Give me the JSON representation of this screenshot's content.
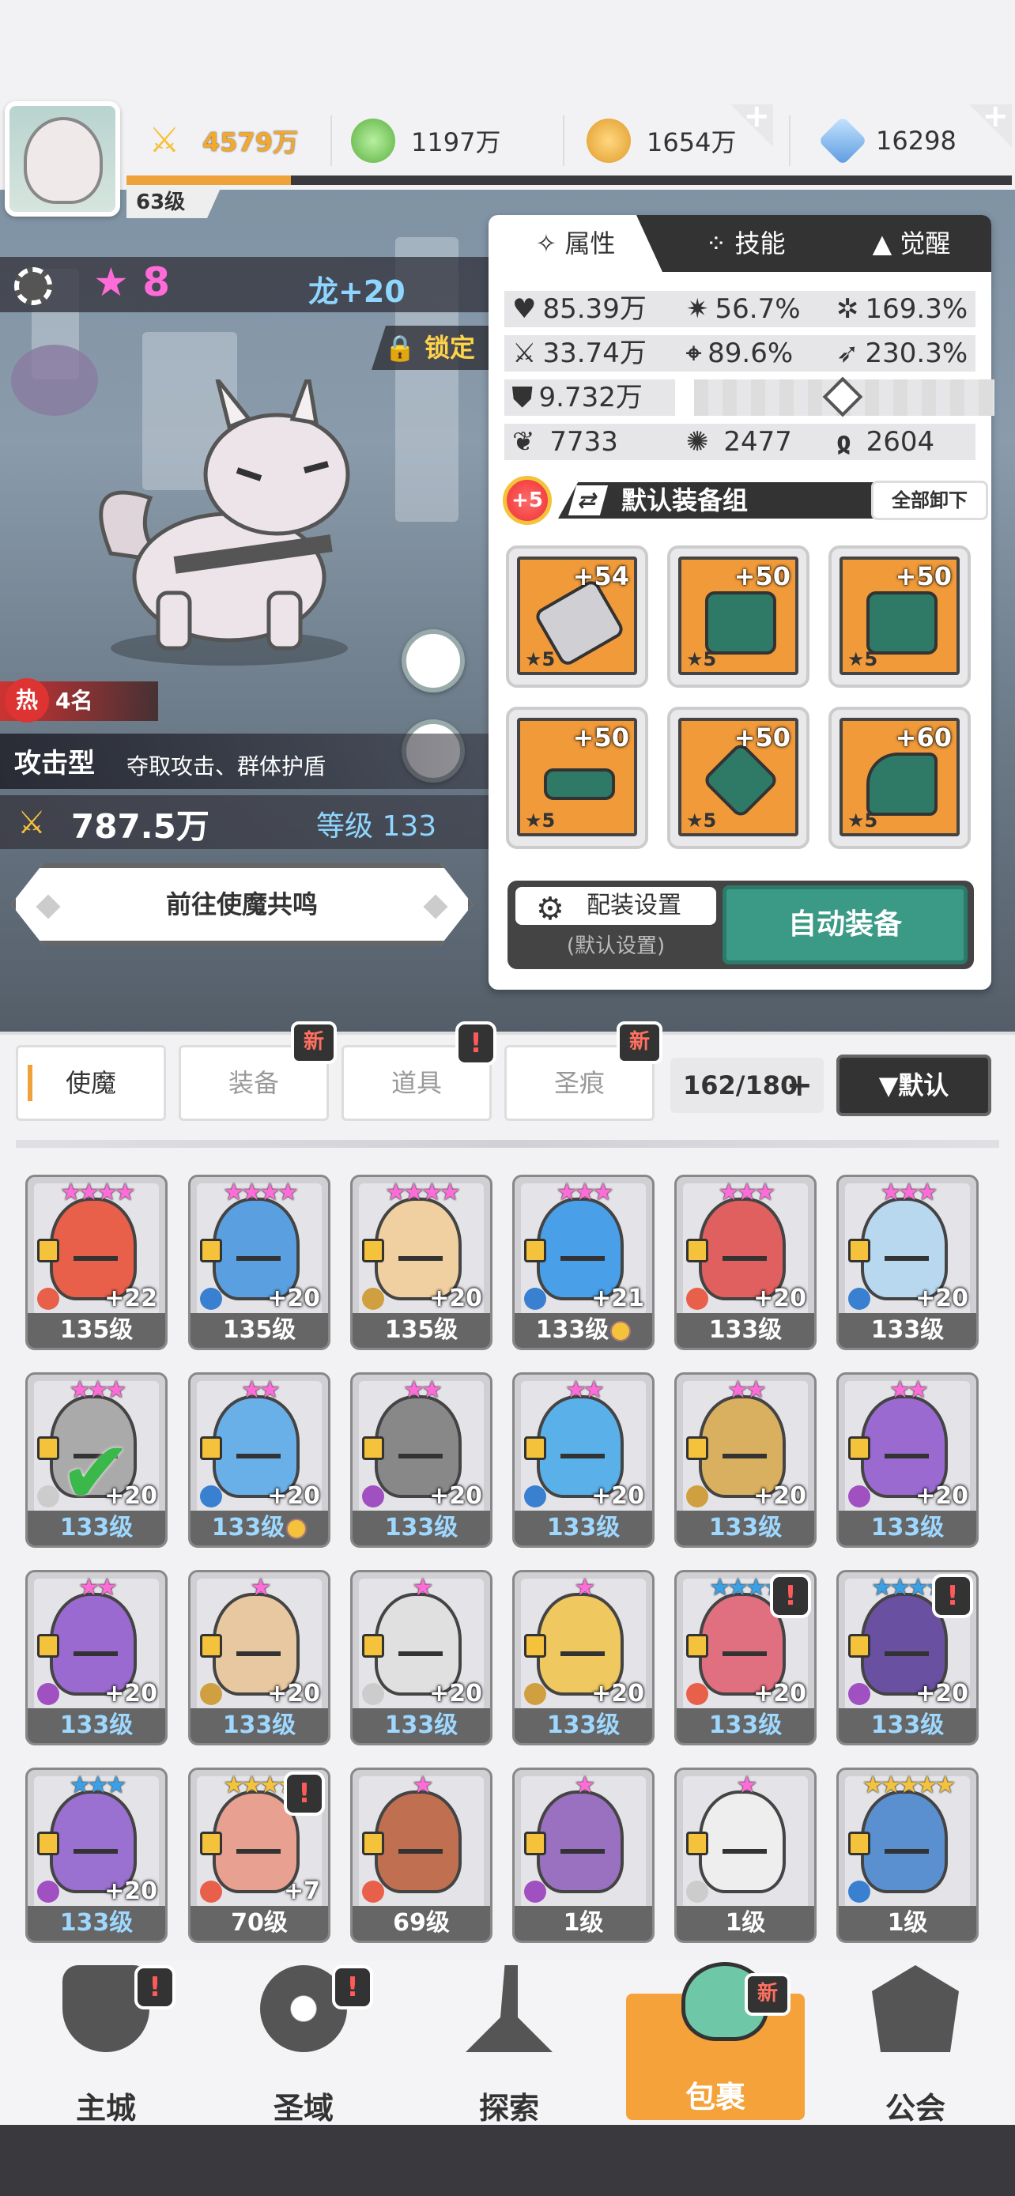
{
  "header": {
    "level": "63级",
    "currencies": [
      {
        "name": "power",
        "value": "4579万",
        "color": "#f5c23b"
      },
      {
        "name": "green-orb",
        "value": "1197万",
        "color": "#7fd060"
      },
      {
        "name": "gold-coin",
        "value": "1654万",
        "color": "#f0b43c"
      },
      {
        "name": "gem",
        "value": "16298",
        "color": "#7fb8f0"
      }
    ]
  },
  "hero": {
    "stars": "8",
    "title": "龙+20",
    "lock_label": "锁定",
    "hot_rank": "4名",
    "hot_icon": "热",
    "type": "攻击型",
    "type_desc": "夺取攻击、群体护盾",
    "power": "787.5万",
    "level": "等级 133",
    "resonance_button": "前往使魔共鸣"
  },
  "panel": {
    "tabs": [
      "属性",
      "技能",
      "觉醒"
    ],
    "stats": {
      "hp": "85.39万",
      "crit": "56.7%",
      "crit_dmg": "169.3%",
      "atk": "33.74万",
      "acc": "89.6%",
      "speed": "230.3%",
      "def": "9.732万",
      "a": "7733",
      "b": "2477",
      "c": "2604"
    },
    "enhance_badge": "+5",
    "equip_set": "默认装备组",
    "unequip_all": "全部卸下",
    "equipment": [
      {
        "level": "+54",
        "stars": "★5",
        "icon": "sword-icon"
      },
      {
        "level": "+50",
        "stars": "★5",
        "icon": "helmet-icon"
      },
      {
        "level": "+50",
        "stars": "★5",
        "icon": "armor-icon"
      },
      {
        "level": "+50",
        "stars": "★5",
        "icon": "belt-icon"
      },
      {
        "level": "+50",
        "stars": "★5",
        "icon": "necklace-icon"
      },
      {
        "level": "+60",
        "stars": "★5",
        "icon": "boots-icon"
      }
    ],
    "config_label": "配装设置",
    "config_sub": "(默认设置)",
    "auto_equip": "自动装备"
  },
  "categories": {
    "tabs": [
      "使魔",
      "装备",
      "道具",
      "圣痕"
    ],
    "new_label": "新",
    "alert_label": "!",
    "count": "162/180",
    "sort": "▼默认"
  },
  "heroes": [
    {
      "stars": "★★★★",
      "plus": "+22",
      "level": "135级",
      "color": "#e8604a",
      "elem": "#e8604a"
    },
    {
      "stars": "★★★★",
      "plus": "+20",
      "level": "135级",
      "color": "#5aa0e0",
      "elem": "#3a80d0"
    },
    {
      "stars": "★★★★",
      "plus": "+20",
      "level": "135级",
      "color": "#f0d0a0",
      "elem": "#d0a040"
    },
    {
      "stars": "★★★",
      "plus": "+21",
      "level": "133级",
      "color": "#4aa0e8",
      "elem": "#3a80d0"
    },
    {
      "stars": "★★★",
      "plus": "+20",
      "level": "133级",
      "color": "#e06060",
      "elem": "#e8604a"
    },
    {
      "stars": "★★★",
      "plus": "+20",
      "level": "133级",
      "color": "#b8d8f0",
      "elem": "#3a80d0"
    },
    {
      "stars": "★★★",
      "plus": "+20",
      "level": "133级",
      "color": "#aaa",
      "elem": "#ccc"
    },
    {
      "stars": "★★",
      "plus": "+20",
      "level": "133级",
      "color": "#6ab0e8",
      "elem": "#3a80d0"
    },
    {
      "stars": "★★",
      "plus": "+20",
      "level": "133级",
      "color": "#888",
      "elem": "#a050c0"
    },
    {
      "stars": "★★",
      "plus": "+20",
      "level": "133级",
      "color": "#5ab0e8",
      "elem": "#3a80d0"
    },
    {
      "stars": "★★",
      "plus": "+20",
      "level": "133级",
      "color": "#d8b060",
      "elem": "#d0a040"
    },
    {
      "stars": "★★",
      "plus": "+20",
      "level": "133级",
      "color": "#9a6ad0",
      "elem": "#a050c0"
    },
    {
      "stars": "★★",
      "plus": "+20",
      "level": "133级",
      "color": "#9a6ad0",
      "elem": "#a050c0"
    },
    {
      "stars": "★",
      "plus": "+20",
      "level": "133级",
      "color": "#e8c8a0",
      "elem": "#d0a040"
    },
    {
      "stars": "★",
      "plus": "+20",
      "level": "133级",
      "color": "#e0e0e0",
      "elem": "#ccc"
    },
    {
      "stars": "★",
      "plus": "+20",
      "level": "133级",
      "color": "#f0c860",
      "elem": "#d0a040"
    },
    {
      "stars": "★★★★",
      "plus": "+20",
      "level": "133级",
      "color": "#e07080",
      "elem": "#e8604a"
    },
    {
      "stars": "★★★★",
      "plus": "+20",
      "level": "133级",
      "color": "#6a50a0",
      "elem": "#a050c0"
    },
    {
      "stars": "★★★",
      "plus": "+20",
      "level": "133级",
      "color": "#9a70d0",
      "elem": "#a050c0"
    },
    {
      "stars": "★★★★",
      "plus": "+7",
      "level": "70级",
      "color": "#e8a090",
      "elem": "#e8604a"
    },
    {
      "stars": "★",
      "plus": "",
      "level": "69级",
      "color": "#c07050",
      "elem": "#e8604a"
    },
    {
      "stars": "★",
      "plus": "",
      "level": "1级",
      "color": "#9a70c0",
      "elem": "#a050c0"
    },
    {
      "stars": "★",
      "plus": "",
      "level": "1级",
      "color": "#eee",
      "elem": "#ccc"
    },
    {
      "stars": "★★★★★",
      "plus": "",
      "level": "1级",
      "color": "#5a90d0",
      "elem": "#3a80d0"
    }
  ],
  "nav": [
    {
      "label": "主城",
      "icon": "castle-icon"
    },
    {
      "label": "圣域",
      "icon": "vortex-icon"
    },
    {
      "label": "探索",
      "icon": "sword-stone-icon"
    },
    {
      "label": "包裹",
      "icon": "bag-icon"
    },
    {
      "label": "公会",
      "icon": "guild-icon"
    }
  ]
}
